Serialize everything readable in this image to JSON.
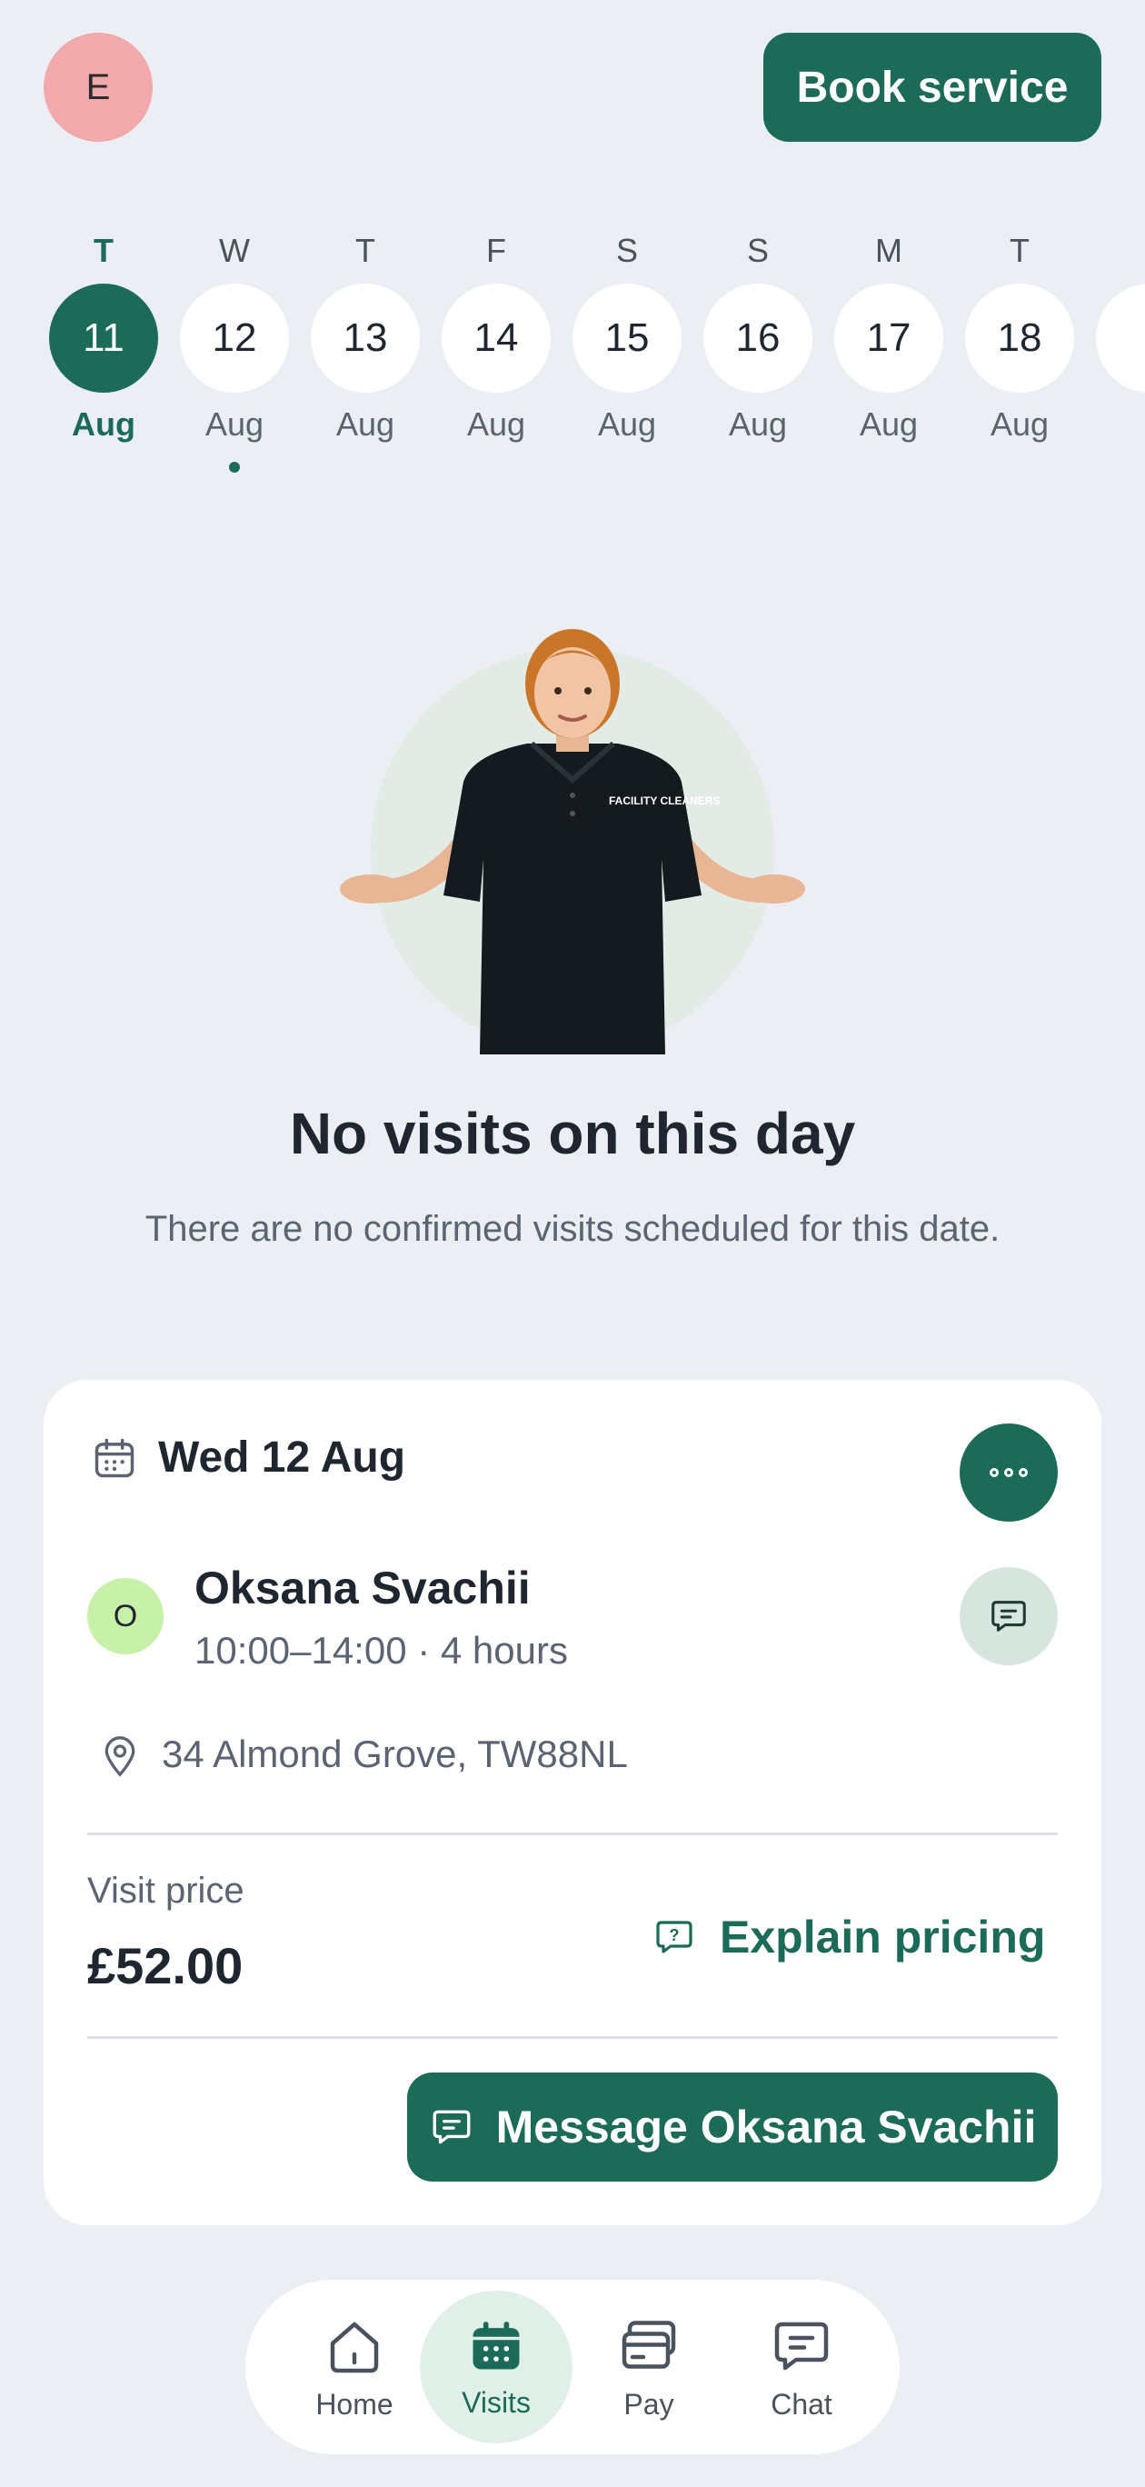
{
  "header": {
    "avatar_initial": "E",
    "book_label": "Book service"
  },
  "date_strip": {
    "days": [
      {
        "dow": "T",
        "date": "11",
        "month": "Aug",
        "selected": true
      },
      {
        "dow": "W",
        "date": "12",
        "month": "Aug",
        "has_visit": true
      },
      {
        "dow": "T",
        "date": "13",
        "month": "Aug"
      },
      {
        "dow": "F",
        "date": "14",
        "month": "Aug"
      },
      {
        "dow": "S",
        "date": "15",
        "month": "Aug"
      },
      {
        "dow": "S",
        "date": "16",
        "month": "Aug"
      },
      {
        "dow": "M",
        "date": "17",
        "month": "Aug"
      },
      {
        "dow": "T",
        "date": "18",
        "month": "Aug"
      }
    ]
  },
  "empty_state": {
    "title": "No visits on this day",
    "subtitle": "There are no confirmed visits scheduled for this date.",
    "shirt_text": "FACILITY CLEANERS"
  },
  "visit_card": {
    "date_label": "Wed 12 Aug",
    "cleaner_initial": "O",
    "cleaner_name": "Oksana Svachii",
    "time_label": "10:00–14:00 · 4 hours",
    "address": "34 Almond Grove, TW88NL",
    "price_label": "Visit price",
    "price": "£52.00",
    "explain_label": "Explain pricing",
    "message_label": "Message Oksana Svachii"
  },
  "nav": {
    "items": [
      {
        "label": "Home",
        "icon": "home-icon"
      },
      {
        "label": "Visits",
        "icon": "calendar-icon",
        "active": true
      },
      {
        "label": "Pay",
        "icon": "card-icon"
      },
      {
        "label": "Chat",
        "icon": "chat-icon"
      }
    ]
  },
  "colors": {
    "brand": "#1c6b58",
    "background": "#ebeef2",
    "avatar": "#f2a9ac"
  }
}
